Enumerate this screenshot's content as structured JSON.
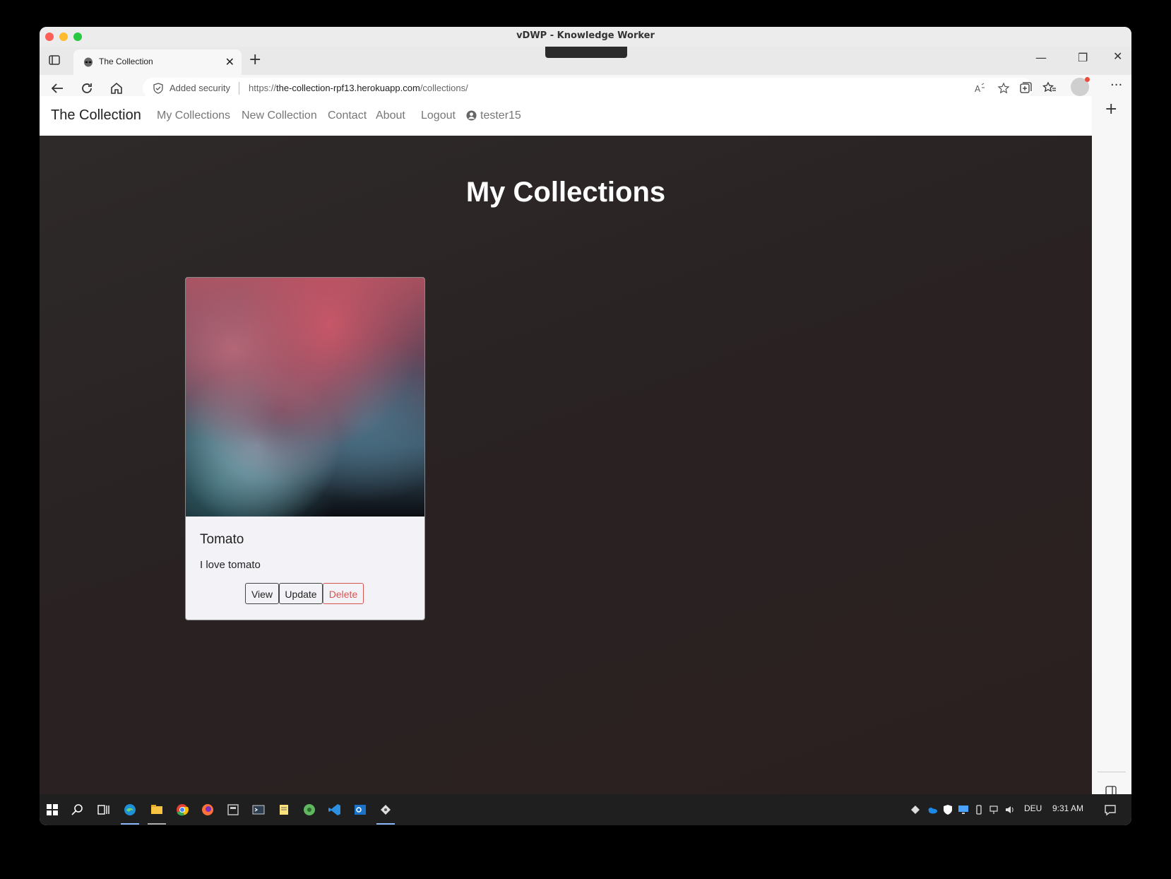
{
  "window": {
    "title": "vDWP - Knowledge Worker"
  },
  "tab": {
    "title": "The Collection"
  },
  "address": {
    "security_label": "Added security",
    "url_prefix": "https://",
    "url_host": "the-collection-rpf13.herokuapp.com",
    "url_path": "/collections/"
  },
  "site": {
    "brand": "The Collection",
    "nav": [
      "My Collections",
      "New Collection",
      "Contact",
      "About",
      "Logout"
    ],
    "username": "tester15"
  },
  "page": {
    "title": "My Collections"
  },
  "card": {
    "title": "Tomato",
    "text": "I love tomato",
    "buttons": {
      "view": "View",
      "update": "Update",
      "delete": "Delete"
    }
  },
  "taskbar": {
    "language": "DEU",
    "time": "9:31 AM"
  },
  "colors": {
    "page_bg": "#2b2525",
    "danger": "#d9534f",
    "accent": "#8ab4f8"
  }
}
